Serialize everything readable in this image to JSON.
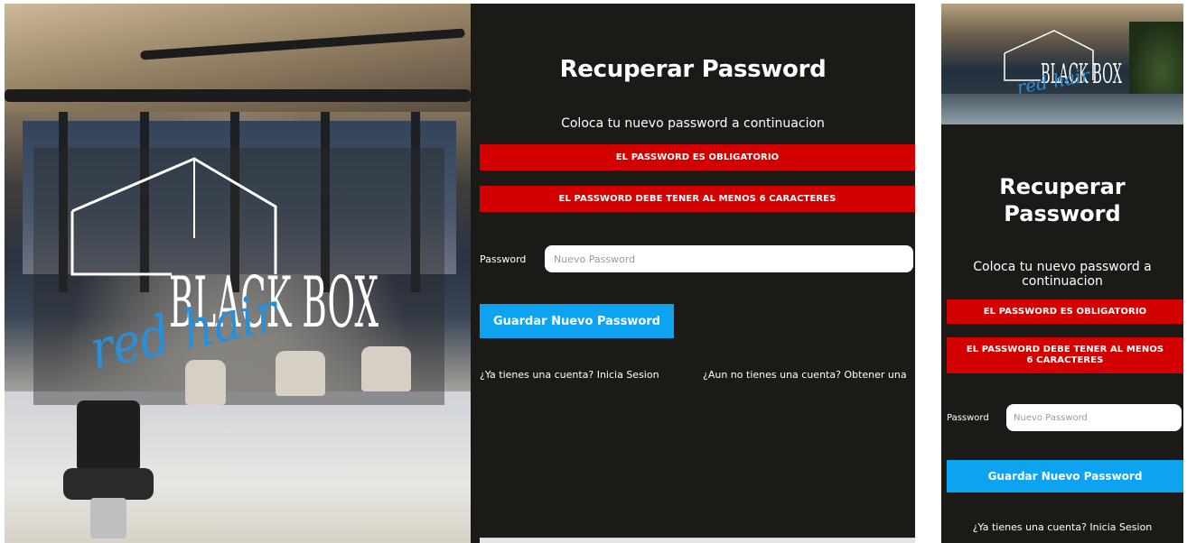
{
  "brand": {
    "logo_main": "BLACK BOX",
    "logo_script": "red hair"
  },
  "form": {
    "title": "Recuperar Password",
    "subtitle": "Coloca tu nuevo password a continuacion",
    "alerts": [
      "EL PASSWORD ES OBLIGATORIO",
      "EL PASSWORD DEBE TENER AL MENOS 6 CARACTERES"
    ],
    "password_label": "Password",
    "password_placeholder": "Nuevo Password",
    "password_value": "",
    "save_label": "Guardar Nuevo Password",
    "login_link": "¿Ya tienes una cuenta? Inicia Sesion",
    "register_link": "¿Aun no tienes una cuenta? Obtener una"
  },
  "colors": {
    "panel_bg": "#1b1a17",
    "alert_bg": "#d30000",
    "button_bg": "#0da3f0",
    "text": "#ffffff"
  }
}
